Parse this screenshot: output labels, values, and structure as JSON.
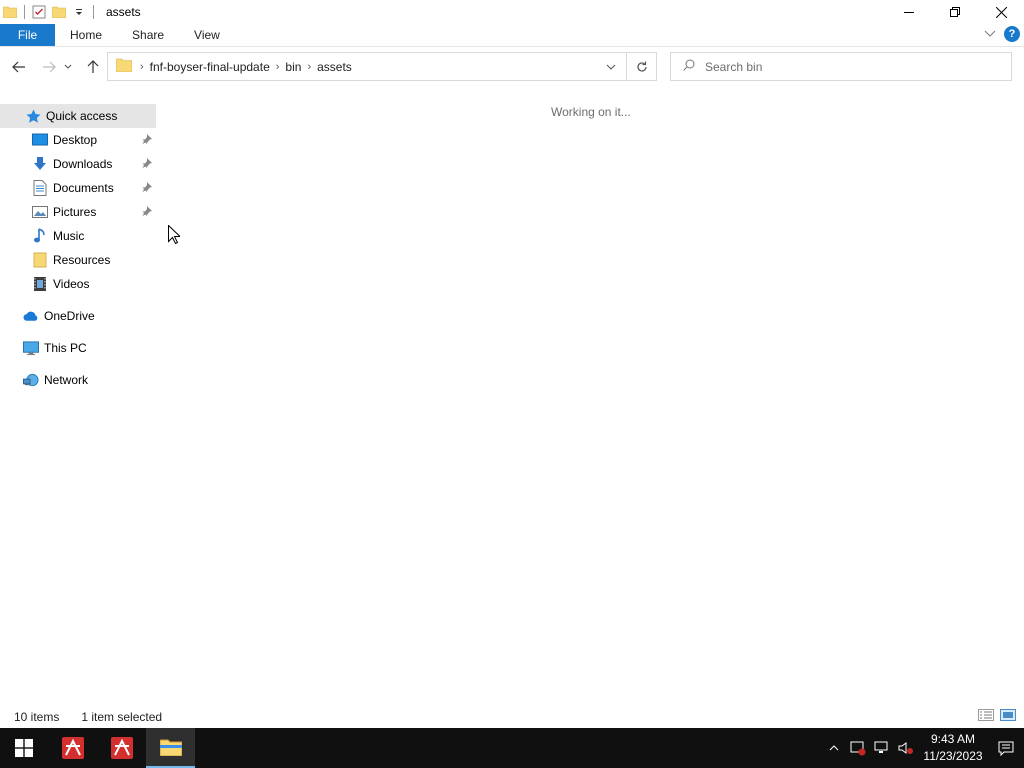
{
  "window": {
    "title": "assets"
  },
  "ribbon": {
    "tabs": [
      "File",
      "Home",
      "Share",
      "View"
    ],
    "help": "?"
  },
  "address": {
    "breadcrumbs": [
      "fnf-boyser-final-update",
      "bin",
      "assets"
    ]
  },
  "search": {
    "placeholder": "Search bin"
  },
  "sidebar": {
    "quick_access": "Quick access",
    "items": [
      {
        "label": "Desktop",
        "icon": "desktop-icon",
        "pinned": true
      },
      {
        "label": "Downloads",
        "icon": "downloads-icon",
        "pinned": true
      },
      {
        "label": "Documents",
        "icon": "documents-icon",
        "pinned": true
      },
      {
        "label": "Pictures",
        "icon": "pictures-icon",
        "pinned": true
      },
      {
        "label": "Music",
        "icon": "music-icon",
        "pinned": false
      },
      {
        "label": "Resources",
        "icon": "folder-icon",
        "pinned": false
      },
      {
        "label": "Videos",
        "icon": "videos-icon",
        "pinned": false
      }
    ],
    "onedrive": "OneDrive",
    "thispc": "This PC",
    "network": "Network"
  },
  "content": {
    "status": "Working on it..."
  },
  "statusbar": {
    "items": "10 items",
    "selected": "1 item selected"
  },
  "taskbar": {
    "time": "9:43 AM",
    "date": "11/23/2023"
  },
  "colors": {
    "accent": "#1979ca",
    "folder": "#f8d775",
    "taskbar": "#101010"
  }
}
